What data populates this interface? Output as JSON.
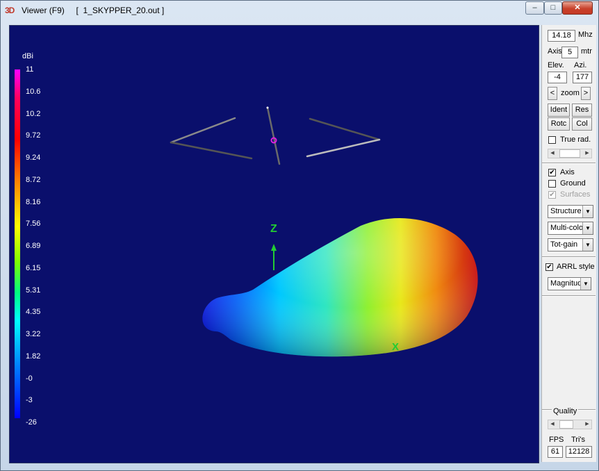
{
  "window": {
    "title_icon": "3D",
    "title": "Viewer (F9)     [  1_SKYPPER_20.out ]",
    "min_symbol": "–",
    "max_symbol": "□",
    "close_symbol": "✕"
  },
  "legend": {
    "unit": "dBi",
    "values": [
      "11",
      "10.6",
      "10.2",
      "9.72",
      "9.24",
      "8.72",
      "8.16",
      "7.56",
      "6.89",
      "6.15",
      "5.31",
      "4.35",
      "3.22",
      "1.82",
      "-0",
      "-3",
      "-26"
    ]
  },
  "axes": {
    "z": "Z",
    "x": "X"
  },
  "panel": {
    "freq_value": "14.18",
    "freq_unit": "Mhz",
    "axis_label": "Axis",
    "axis_value": "5",
    "axis_unit": "mtr",
    "elev_label": "Elev.",
    "azi_label": "Azi.",
    "elev_value": "-4",
    "azi_value": "177",
    "zoom_left": "<",
    "zoom_label": "zoom",
    "zoom_right": ">",
    "ident_label": "Ident",
    "res_label": "Res",
    "rotc_label": "Rotc",
    "col_label": "Col",
    "true_rad_label": "True rad.",
    "axis_check_label": "Axis",
    "ground_label": "Ground",
    "surfaces_label": "Surfaces",
    "structure_select": "Structure",
    "color_select": "Multi-colo",
    "gain_select": "Tot-gain",
    "arrl_label": "ARRL style",
    "magnitude_select": "Magnitud",
    "quality_label": "Quality",
    "fps_label": "FPS",
    "tris_label": "Tri's",
    "fps_value": "61",
    "tris_value": "12128"
  },
  "colors": {
    "viewport_bg": "#0a0f6c",
    "legend_text": "#ffffff",
    "axis_color": "#22cc33"
  }
}
